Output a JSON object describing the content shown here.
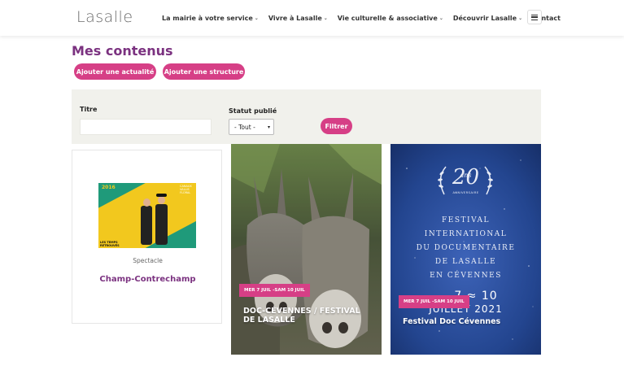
{
  "header": {
    "logo": "Lasalle",
    "nav": [
      {
        "label": "La mairie à votre service",
        "has_dropdown": true
      },
      {
        "label": "Vivre à Lasalle",
        "has_dropdown": true
      },
      {
        "label": "Vie culturelle & associative",
        "has_dropdown": true
      },
      {
        "label": "Découvrir Lasalle",
        "has_dropdown": true
      },
      {
        "label": "Contact",
        "has_dropdown": false
      }
    ],
    "menu_icon": "hamburger-icon"
  },
  "page": {
    "title": "Mes contenus",
    "add_news_label": "Ajouter une actualité",
    "add_structure_label": "Ajouter une structure"
  },
  "filter": {
    "title_label": "Titre",
    "title_value": "",
    "status_label": "Statut publié",
    "status_selected": "- Tout -",
    "submit_label": "Filtrer"
  },
  "cards": [
    {
      "category": "Spectacle",
      "title": "Champ-Contrechamp",
      "poster": {
        "year": "2016",
        "tagline": "CANAUX\nVALLIS\nFLORAL",
        "footer": "LES TEMPS\nRETROUVÉS"
      }
    },
    {
      "date": "MER 7 JUIL -SAM 10 JUIL",
      "title": "DOC-CÉVENNES / FESTIVAL DE LASALLE"
    },
    {
      "date": "MER 7 JUIL -SAM 10 JUIL",
      "title": "Festival Doc Cévennes",
      "poster": {
        "badge": "ans",
        "badge_number": "20",
        "badge_sub": "ANNIVERSAIRE",
        "lines": [
          "FESTIVAL",
          "INTERNATIONAL",
          "DU DOCUMENTAIRE",
          "DE LASALLE",
          "EN CÉVENNES"
        ],
        "dates": "7 ≈ 10",
        "month": "JUILLET 2021"
      }
    }
  ],
  "colors": {
    "accent": "#d63f86",
    "title": "#7b3280",
    "filter_bg": "#f1f1ec"
  }
}
